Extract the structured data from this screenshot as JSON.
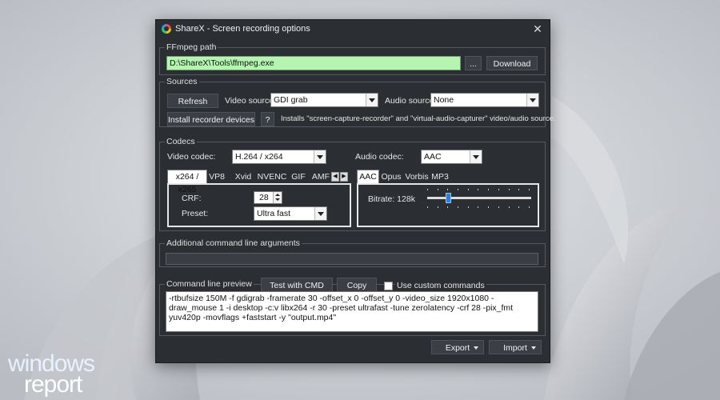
{
  "window": {
    "title": "ShareX - Screen recording options"
  },
  "ffmpeg": {
    "legend": "FFmpeg path",
    "path": "D:\\ShareX\\Tools\\ffmpeg.exe",
    "browse_label": "...",
    "download_label": "Download"
  },
  "sources": {
    "legend": "Sources",
    "refresh_label": "Refresh",
    "video_source_label": "Video source:",
    "video_source_value": "GDI grab",
    "audio_source_label": "Audio source:",
    "audio_source_value": "None",
    "install_label": "Install recorder devices",
    "help_label": "?",
    "install_desc": "Installs \"screen-capture-recorder\" and \"virtual-audio-capturer\" video/audio source."
  },
  "codecs": {
    "legend": "Codecs",
    "video_codec_label": "Video codec:",
    "video_codec_value": "H.264 / x264",
    "audio_codec_label": "Audio codec:",
    "audio_codec_value": "AAC",
    "video_tabs": [
      "x264 / x265",
      "VP8",
      "Xvid",
      "NVENC",
      "GIF",
      "AMF"
    ],
    "scroll_left": "◀",
    "scroll_right": "▶",
    "crf_label": "CRF:",
    "crf_value": "28",
    "preset_label": "Preset:",
    "preset_value": "Ultra fast",
    "audio_tabs": [
      "AAC",
      "Opus",
      "Vorbis",
      "MP3"
    ],
    "bitrate_label": "Bitrate: 128k",
    "bitrate_fraction": 0.2
  },
  "additional": {
    "legend": "Additional command line arguments",
    "value": ""
  },
  "preview": {
    "legend": "Command line preview",
    "test_label": "Test with CMD",
    "copy_label": "Copy",
    "custom_label": "Use custom commands",
    "text": "-rtbufsize 150M -f gdigrab -framerate 30 -offset_x 0 -offset_y 0 -video_size 1920x1080 -draw_mouse 1 -i desktop -c:v libx264 -r 30 -preset ultrafast -tune zerolatency -crf 28 -pix_fmt yuv420p -movflags +faststart -y \"output.mp4\""
  },
  "footer": {
    "export_label": "Export",
    "import_label": "Import"
  },
  "watermark": {
    "line1": "windows",
    "line2": "report"
  }
}
